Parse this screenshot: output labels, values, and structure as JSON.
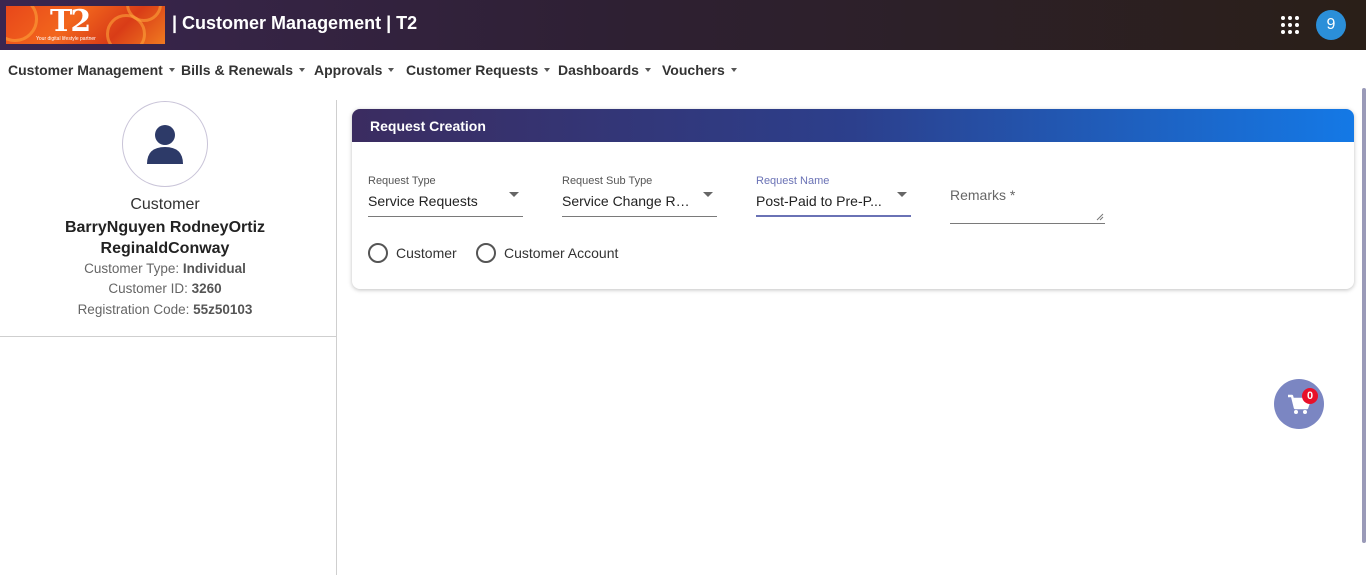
{
  "header": {
    "app_title": "| Customer Management | T2",
    "logo_mark": "T2",
    "logo_tagline": "Your digital lifestyle partner",
    "user_initial": "9",
    "apps_icon": "grid-apps-icon"
  },
  "nav": {
    "items": [
      {
        "label": "Customer Management"
      },
      {
        "label": "Bills & Renewals"
      },
      {
        "label": "Approvals"
      },
      {
        "label": "Customer Requests"
      },
      {
        "label": "Dashboards"
      },
      {
        "label": "Vouchers"
      }
    ]
  },
  "profile": {
    "role": "Customer",
    "name_line1": "BarryNguyen RodneyOrtiz",
    "name_line2": "ReginaldConway",
    "type_label": "Customer Type: ",
    "type_value": "Individual",
    "id_label": "Customer ID: ",
    "id_value": "3260",
    "reg_label": "Registration Code: ",
    "reg_value": "55z50103"
  },
  "request_form": {
    "title": "Request Creation",
    "request_type": {
      "label": "Request Type",
      "value": "Service Requests"
    },
    "request_sub_type": {
      "label": "Request Sub Type",
      "value": "Service Change Re..."
    },
    "request_name": {
      "label": "Request Name",
      "value": "Post-Paid to Pre-P..."
    },
    "remarks": {
      "label": "Remarks *"
    },
    "radio_options": [
      {
        "label": "Customer",
        "selected": false
      },
      {
        "label": "Customer Account",
        "selected": false
      }
    ]
  },
  "cart": {
    "count": "0",
    "icon": "shopping-cart-icon"
  },
  "colors": {
    "header_bg": "#2e2033",
    "card_header_start": "#3b2c60",
    "card_header_end": "#1479e6",
    "accent": "#6a72b5",
    "avatar_bg": "#2b8fd9",
    "cart_bg": "#7b86c2",
    "badge_bg": "#e8102a"
  }
}
